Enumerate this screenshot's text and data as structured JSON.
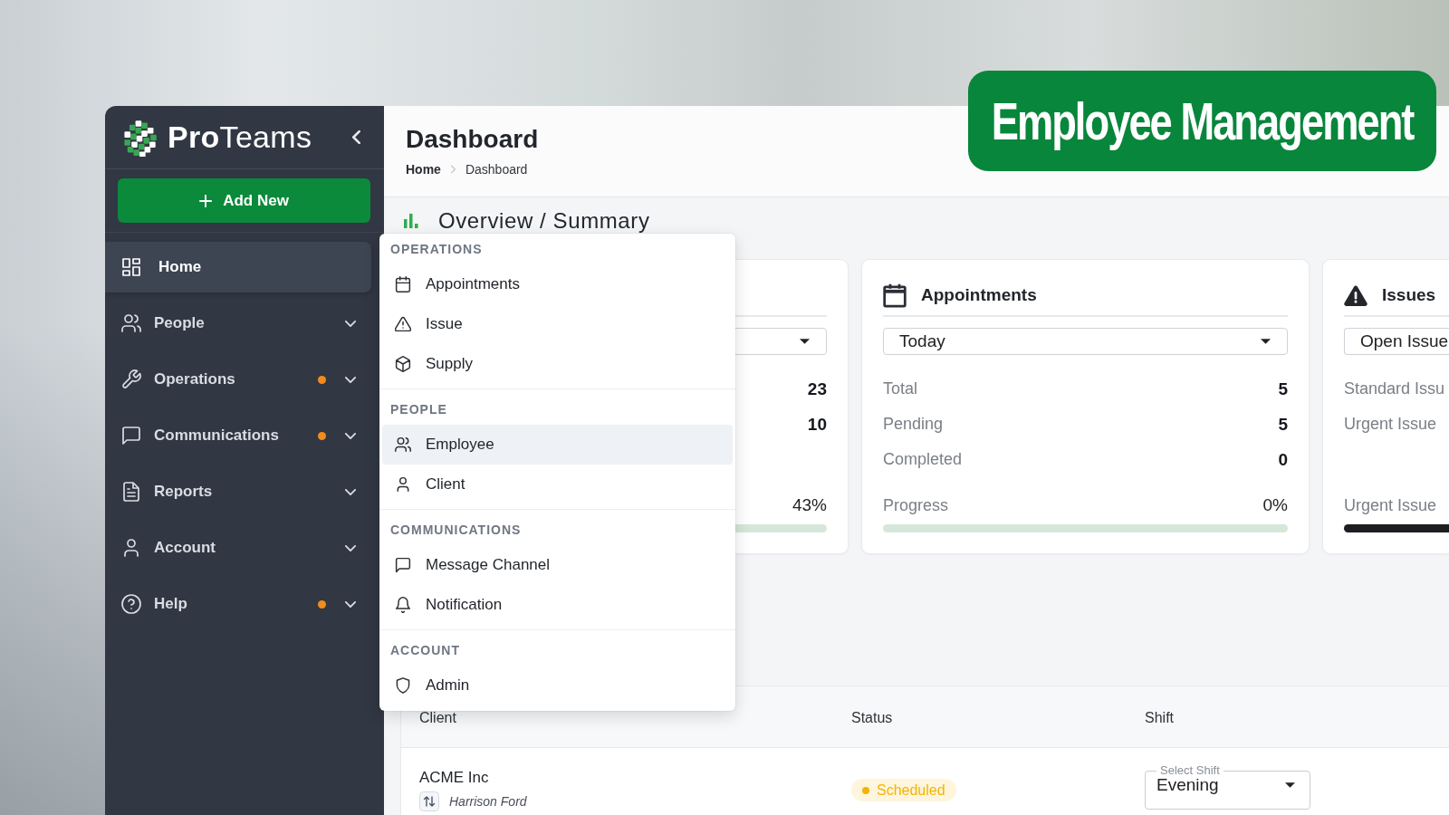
{
  "banner": {
    "text": "Employee Management"
  },
  "sidebar": {
    "brand": "**Pro**Teams",
    "add_button": "Add New",
    "items": [
      {
        "label": "Home",
        "kind": "link",
        "selected": true,
        "notification": false
      },
      {
        "label": "People",
        "kind": "group",
        "selected": false,
        "notification": false
      },
      {
        "label": "Operations",
        "kind": "group",
        "selected": false,
        "notification": true
      },
      {
        "label": "Communications",
        "kind": "group",
        "selected": false,
        "notification": true
      },
      {
        "label": "Reports",
        "kind": "group",
        "selected": false,
        "notification": false
      },
      {
        "label": "Account",
        "kind": "group",
        "selected": false,
        "notification": false
      },
      {
        "label": "Help",
        "kind": "group",
        "selected": false,
        "notification": true
      }
    ]
  },
  "header": {
    "title": "Dashboard",
    "breadcrumb": [
      {
        "label": "Home",
        "current": false
      },
      {
        "label": "Dashboard",
        "current": true
      }
    ]
  },
  "overview": {
    "title": "Overview / Summary"
  },
  "menu": {
    "sections": [
      {
        "heading": "OPERATIONS",
        "items": [
          {
            "label": "Appointments",
            "selected": false
          },
          {
            "label": "Issue",
            "selected": false
          },
          {
            "label": "Supply",
            "selected": false
          }
        ]
      },
      {
        "heading": "PEOPLE",
        "items": [
          {
            "label": "Employee",
            "selected": true
          },
          {
            "label": "Client",
            "selected": false
          }
        ]
      },
      {
        "heading": "COMMUNICATIONS",
        "items": [
          {
            "label": "Message Channel",
            "selected": false
          },
          {
            "label": "Notification",
            "selected": false
          }
        ]
      },
      {
        "heading": "ACCOUNT",
        "items": [
          {
            "label": "Admin",
            "selected": false
          }
        ]
      }
    ]
  },
  "cards": [
    {
      "rows": [
        {
          "value": "23"
        },
        {
          "value": "10"
        }
      ],
      "progress": {
        "kind": "meter",
        "reading": "43%"
      }
    },
    {
      "title": "Appointments",
      "filter": "Today",
      "rows": [
        {
          "label": "Total",
          "value": "5"
        },
        {
          "label": "Pending",
          "value": "5"
        },
        {
          "label": "Completed",
          "value": "0"
        }
      ],
      "progress": {
        "kind": "meter",
        "label": "Progress",
        "reading": "0%"
      }
    },
    {
      "title": "Issues",
      "filter": "Open Issue",
      "rows": [
        {
          "label": "Standard Issu"
        },
        {
          "label": "Urgent Issue"
        }
      ],
      "progress": {
        "kind": "alert",
        "label": "Urgent Issue"
      }
    }
  ],
  "table": {
    "columns": [
      "Client",
      "Status",
      "Shift"
    ],
    "rows": [
      {
        "client": "ACME Inc",
        "contact": "Harrison Ford",
        "status": {
          "label": "Scheduled",
          "color": "#f5b301"
        },
        "shift": {
          "label": "Select Shift",
          "value": "Evening"
        }
      }
    ]
  }
}
